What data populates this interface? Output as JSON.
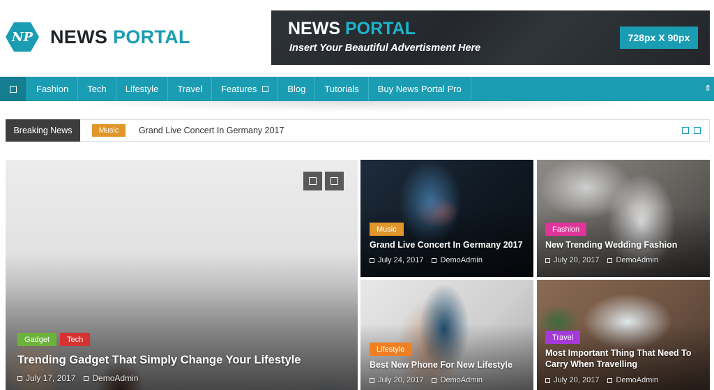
{
  "brand": {
    "logo_initials": "NP",
    "name_part1": "NEWS",
    "name_part2": "PORTAL"
  },
  "ad": {
    "title_part1": "NEWS",
    "title_part2": "PORTAL",
    "subtitle": "Insert Your Beautiful Advertisment Here",
    "size": "728px X 90px"
  },
  "nav": {
    "items": [
      {
        "label": "Fashion"
      },
      {
        "label": "Tech"
      },
      {
        "label": "Lifestyle"
      },
      {
        "label": "Travel"
      },
      {
        "label": "Features"
      },
      {
        "label": "Blog"
      },
      {
        "label": "Tutorials"
      },
      {
        "label": "Buy News Portal Pro"
      }
    ],
    "search_glyph": "fl"
  },
  "ticker": {
    "label": "Breaking News",
    "category": "Music",
    "headline": "Grand Live Concert In Germany 2017"
  },
  "featured": {
    "categories": [
      {
        "label": "Gadget",
        "color": "#6bb33a"
      },
      {
        "label": "Tech",
        "color": "#d63232"
      }
    ],
    "title": "Trending Gadget That Simply Change Your Lifestyle",
    "date": "July 17, 2017",
    "author": "DemoAdmin"
  },
  "grid": [
    {
      "category": "Music",
      "color": "#e0962b",
      "title": "Grand Live Concert In Germany 2017",
      "date": "July 24, 2017",
      "author": "DemoAdmin"
    },
    {
      "category": "Fashion",
      "color": "#e0349a",
      "title": "New Trending Wedding Fashion",
      "date": "July 20, 2017",
      "author": "DemoAdmin"
    },
    {
      "category": "Lifestyle",
      "color": "#ef7f22",
      "title": "Best New Phone For New Lifestyle",
      "date": "July 20, 2017",
      "author": "DemoAdmin"
    },
    {
      "category": "Travel",
      "color": "#a43bd8",
      "title": "Most Important Thing That Need To Carry When Travelling",
      "date": "July 20, 2017",
      "author": "DemoAdmin"
    }
  ]
}
